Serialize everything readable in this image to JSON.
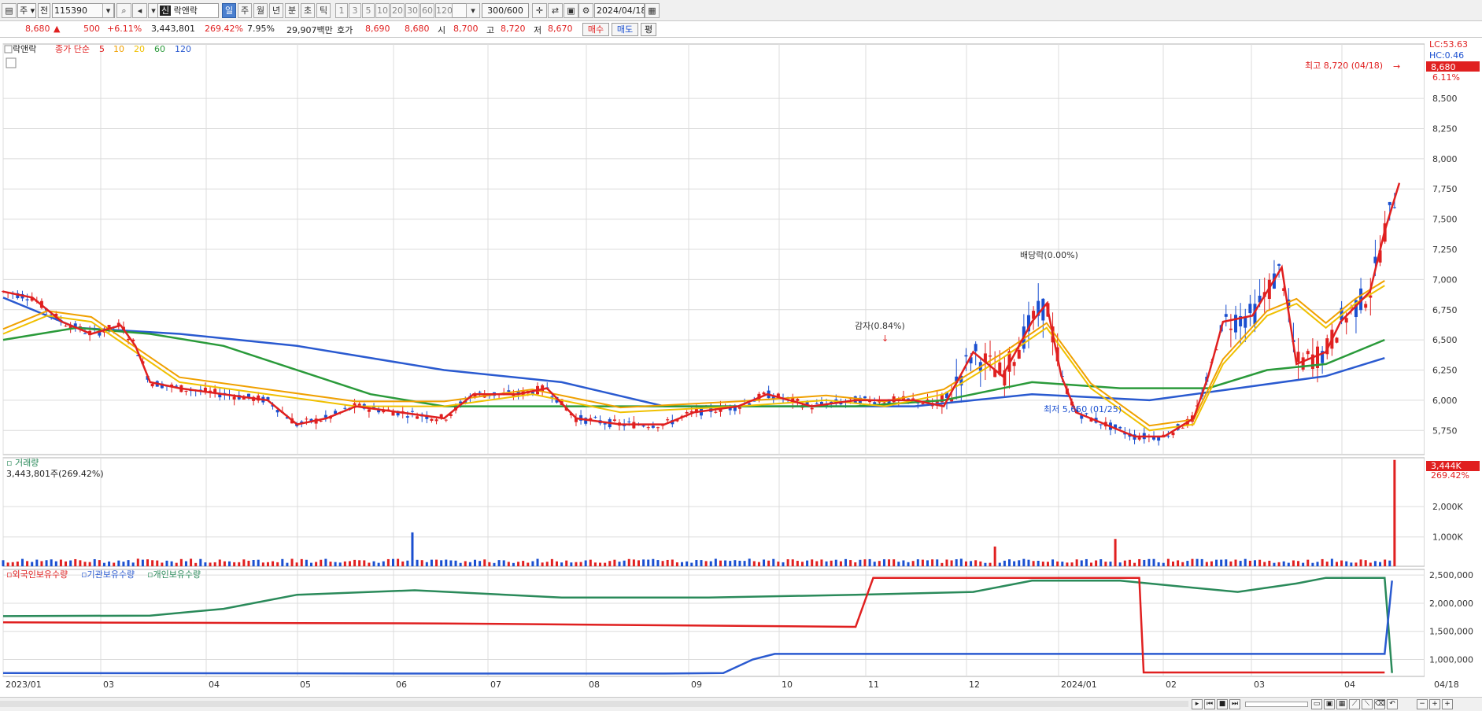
{
  "toolbar": {
    "period_type": "주",
    "compare": "전",
    "code": "115390",
    "name_badge": "신",
    "name": "락앤락",
    "tabs": [
      "일",
      "주",
      "월",
      "년",
      "분",
      "초",
      "틱"
    ],
    "active_tab": "일",
    "intervals": [
      "1",
      "3",
      "5",
      "10",
      "20",
      "30",
      "60",
      "120"
    ],
    "count": "300",
    "count_total": "/600",
    "date": "2024/04/18"
  },
  "quote": {
    "price": "8,680",
    "arrow": "▲",
    "change": "500",
    "change_pct": "+6.11%",
    "volume": "3,443,801",
    "volume_pct": "269.42%",
    "turnover": "7.95%",
    "amount": "29,907백만",
    "bid_label": "호가",
    "bid1": "8,690",
    "bid2": "8,680",
    "open_label": "시",
    "open": "8,700",
    "high_label": "고",
    "high": "8,720",
    "low_label": "저",
    "low": "8,670",
    "buy": "매수",
    "sell": "매도",
    "avg": "평"
  },
  "price_pane": {
    "stock_tag": "락앤락",
    "ma_label": "종가 단순",
    "ma_periods": [
      "5",
      "10",
      "20",
      "60",
      "120"
    ],
    "ma_colors": [
      "#e02020",
      "#f0a000",
      "#f0c000",
      "#2a9a3a",
      "#2a5ad0"
    ],
    "right_labels": {
      "lc": "LC:53.63",
      "hc": "HC:0.46",
      "price": "8,680",
      "pct": "6.11%"
    },
    "high_note": "최고 8,720 (04/18)",
    "low_note": "최저 5,650 (01/25)",
    "event1": "감자(0.84%)",
    "event2": "배당락(0.00%)"
  },
  "volume_pane": {
    "title": "거래량",
    "sub": "3,443,801주(269.42%)",
    "last_label": "3,444K",
    "last_pct": "269.42%"
  },
  "holdings_pane": {
    "series": [
      "외국인보유수량",
      "기관보유수량",
      "개인보유수량"
    ],
    "colors": [
      "#e02020",
      "#2a5ad0",
      "#2a8a5a"
    ]
  },
  "x_labels": [
    "2023/01",
    "03",
    "04",
    "05",
    "06",
    "07",
    "08",
    "09",
    "10",
    "11",
    "12",
    "2024/01",
    "02",
    "03",
    "04"
  ],
  "x_last": "04/18",
  "chart_data": {
    "type": "line",
    "price_axis": {
      "ticks": [
        5750,
        6000,
        6250,
        6500,
        6750,
        7000,
        7250,
        7500,
        7750,
        8000,
        8250,
        8500
      ],
      "ylim": [
        5550,
        8950
      ]
    },
    "volume_axis": {
      "ticks": [
        "1,000K",
        "2,000K"
      ]
    },
    "holdings_axis": {
      "ticks": [
        "1,000,000",
        "1,500,000",
        "2,000,000",
        "2,500,000"
      ],
      "ylim": [
        700000,
        2600000
      ]
    },
    "ma5": [
      [
        0,
        6900
      ],
      [
        0.02,
        6850
      ],
      [
        0.04,
        6650
      ],
      [
        0.06,
        6550
      ],
      [
        0.08,
        6620
      ],
      [
        0.09,
        6450
      ],
      [
        0.1,
        6150
      ],
      [
        0.12,
        6100
      ],
      [
        0.15,
        6050
      ],
      [
        0.18,
        6000
      ],
      [
        0.2,
        5800
      ],
      [
        0.22,
        5850
      ],
      [
        0.24,
        5950
      ],
      [
        0.27,
        5900
      ],
      [
        0.3,
        5850
      ],
      [
        0.32,
        6050
      ],
      [
        0.35,
        6050
      ],
      [
        0.37,
        6100
      ],
      [
        0.39,
        5850
      ],
      [
        0.42,
        5800
      ],
      [
        0.45,
        5800
      ],
      [
        0.47,
        5900
      ],
      [
        0.5,
        5950
      ],
      [
        0.52,
        6050
      ],
      [
        0.55,
        5950
      ],
      [
        0.58,
        6000
      ],
      [
        0.6,
        6000
      ],
      [
        0.62,
        6000
      ],
      [
        0.64,
        5950
      ],
      [
        0.66,
        6400
      ],
      [
        0.68,
        6200
      ],
      [
        0.7,
        6650
      ],
      [
        0.71,
        6800
      ],
      [
        0.72,
        6200
      ],
      [
        0.73,
        5900
      ],
      [
        0.75,
        5800
      ],
      [
        0.77,
        5700
      ],
      [
        0.79,
        5700
      ],
      [
        0.81,
        5850
      ],
      [
        0.82,
        6200
      ],
      [
        0.83,
        6650
      ],
      [
        0.85,
        6700
      ],
      [
        0.87,
        7100
      ],
      [
        0.88,
        6300
      ],
      [
        0.9,
        6400
      ],
      [
        0.91,
        6650
      ],
      [
        0.93,
        6900
      ],
      [
        0.94,
        7400
      ],
      [
        0.95,
        7800
      ]
    ],
    "ma20": [
      [
        0,
        6550
      ],
      [
        0.03,
        6700
      ],
      [
        0.06,
        6650
      ],
      [
        0.09,
        6400
      ],
      [
        0.12,
        6150
      ],
      [
        0.18,
        6050
      ],
      [
        0.24,
        5950
      ],
      [
        0.3,
        5950
      ],
      [
        0.36,
        6050
      ],
      [
        0.42,
        5900
      ],
      [
        0.5,
        5950
      ],
      [
        0.56,
        6000
      ],
      [
        0.6,
        5950
      ],
      [
        0.64,
        6050
      ],
      [
        0.68,
        6350
      ],
      [
        0.71,
        6600
      ],
      [
        0.74,
        6100
      ],
      [
        0.78,
        5750
      ],
      [
        0.81,
        5800
      ],
      [
        0.83,
        6300
      ],
      [
        0.86,
        6700
      ],
      [
        0.88,
        6800
      ],
      [
        0.9,
        6600
      ],
      [
        0.92,
        6800
      ],
      [
        0.94,
        6950
      ]
    ],
    "ma60": [
      [
        0,
        6500
      ],
      [
        0.05,
        6600
      ],
      [
        0.1,
        6550
      ],
      [
        0.15,
        6450
      ],
      [
        0.2,
        6250
      ],
      [
        0.25,
        6050
      ],
      [
        0.3,
        5950
      ],
      [
        0.35,
        5950
      ],
      [
        0.4,
        5950
      ],
      [
        0.5,
        5950
      ],
      [
        0.58,
        5950
      ],
      [
        0.64,
        6000
      ],
      [
        0.7,
        6150
      ],
      [
        0.76,
        6100
      ],
      [
        0.82,
        6100
      ],
      [
        0.86,
        6250
      ],
      [
        0.9,
        6300
      ],
      [
        0.94,
        6500
      ]
    ],
    "ma120": [
      [
        0,
        6850
      ],
      [
        0.05,
        6600
      ],
      [
        0.12,
        6550
      ],
      [
        0.2,
        6450
      ],
      [
        0.3,
        6250
      ],
      [
        0.38,
        6150
      ],
      [
        0.45,
        5950
      ],
      [
        0.55,
        5950
      ],
      [
        0.62,
        5950
      ],
      [
        0.7,
        6050
      ],
      [
        0.78,
        6000
      ],
      [
        0.84,
        6100
      ],
      [
        0.9,
        6200
      ],
      [
        0.94,
        6350
      ]
    ],
    "foreign_holdings": [
      [
        0,
        1660000
      ],
      [
        0.3,
        1640000
      ],
      [
        0.58,
        1580000
      ],
      [
        0.592,
        2450000
      ],
      [
        0.773,
        2450000
      ],
      [
        0.776,
        770000
      ],
      [
        0.94,
        770000
      ]
    ],
    "institution_holdings": [
      [
        0,
        760000
      ],
      [
        0.3,
        750000
      ],
      [
        0.45,
        750000
      ],
      [
        0.49,
        760000
      ],
      [
        0.51,
        1000000
      ],
      [
        0.525,
        1100000
      ],
      [
        0.94,
        1100000
      ],
      [
        0.945,
        2400000
      ]
    ],
    "individual_holdings": [
      [
        0,
        1770000
      ],
      [
        0.1,
        1780000
      ],
      [
        0.15,
        1900000
      ],
      [
        0.2,
        2150000
      ],
      [
        0.28,
        2230000
      ],
      [
        0.38,
        2100000
      ],
      [
        0.48,
        2100000
      ],
      [
        0.58,
        2150000
      ],
      [
        0.66,
        2200000
      ],
      [
        0.7,
        2400000
      ],
      [
        0.76,
        2400000
      ],
      [
        0.8,
        2300000
      ],
      [
        0.84,
        2200000
      ],
      [
        0.88,
        2350000
      ],
      [
        0.9,
        2450000
      ],
      [
        0.94,
        2450000
      ],
      [
        0.945,
        760000
      ]
    ]
  },
  "colors": {
    "grid": "#dcdcdc",
    "up": "#e02020",
    "down": "#1a4fd0"
  }
}
